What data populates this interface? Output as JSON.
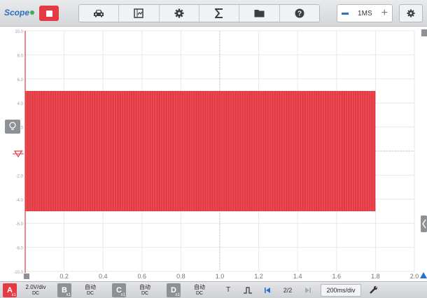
{
  "app": {
    "name": "Scope"
  },
  "toolbar": {
    "buttons": [
      "car-icon",
      "cursor-panel-icon",
      "gear-icon",
      "sigma-icon",
      "folder-icon",
      "help-icon"
    ],
    "zoom_label": "1MS",
    "zoom_plus": "+"
  },
  "colors": {
    "waveform": "#e43a44",
    "accent": "#2a6fd1"
  },
  "chart_data": {
    "type": "line",
    "title": "",
    "xlabel": "",
    "ylabel": "",
    "xlim": [
      0,
      2.0
    ],
    "ylim": [
      -10.0,
      10.0
    ],
    "x_ticks": [
      "0",
      "0.2",
      "0.4",
      "0.6",
      "0.8",
      "1.0",
      "1.2",
      "1.4",
      "1.6",
      "1.8",
      "2.0"
    ],
    "y_ticks": [
      "10.0",
      "8.0",
      "6.0",
      "4.0",
      "2.0",
      "0",
      "-2.0",
      "-4.0",
      "-6.0",
      "-8.0",
      "-10.0"
    ],
    "grid": true,
    "series": [
      {
        "channel": "A",
        "x_start": 0,
        "x_end": 1.8,
        "y_high": 5.0,
        "y_low": -5.0,
        "shape": "square wave"
      }
    ]
  },
  "bottom": {
    "channels": [
      {
        "label": "A",
        "sub": "x1",
        "line1": "2.0V/div",
        "line2": "DC",
        "active": true
      },
      {
        "label": "B",
        "sub": "x1",
        "line1": "自动",
        "line2": "DC",
        "active": false
      },
      {
        "label": "C",
        "sub": "x1",
        "line1": "自动",
        "line2": "DC",
        "active": false
      },
      {
        "label": "D",
        "sub": "x1",
        "line1": "自动",
        "line2": "DC",
        "active": false
      }
    ],
    "trigger_label": "T",
    "page": "2/2",
    "timebase": "200ms/div"
  }
}
